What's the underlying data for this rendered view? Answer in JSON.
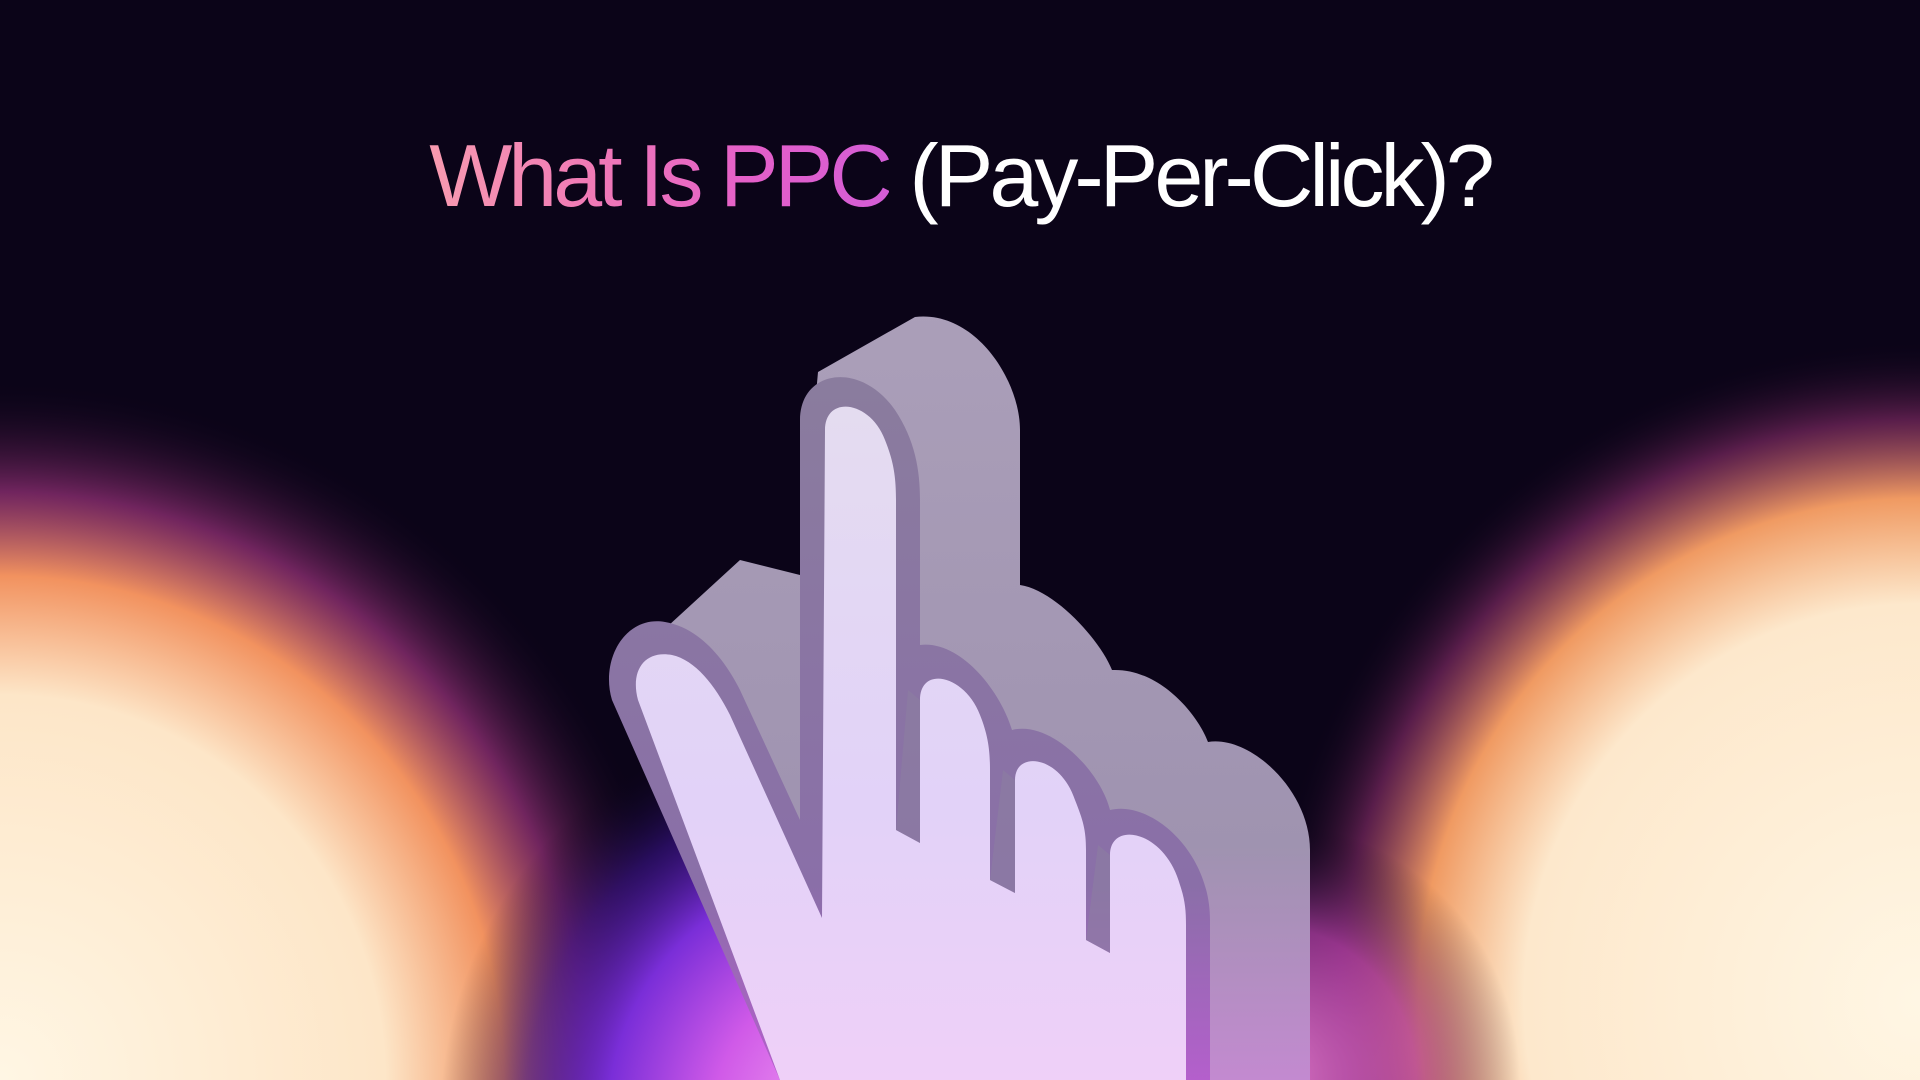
{
  "title": {
    "accent": "What Is PPC",
    "rest": " (Pay-Per-Click)?"
  },
  "icons": {
    "main": "pointing-hand-cursor-icon"
  },
  "colors": {
    "background": "#0b0418",
    "title_text": "#ffffff",
    "title_gradient_start": "#f89bb0",
    "title_gradient_end": "#d35dd6",
    "glow_warm": "#fff4dc",
    "glow_orange": "#f08a5a",
    "glow_magenta": "#c04de0",
    "glow_violet": "#6a2bd8",
    "hand_face": "#e7dcf6",
    "hand_side": "#a59bb5",
    "hand_edge": "#8a7d9c"
  }
}
